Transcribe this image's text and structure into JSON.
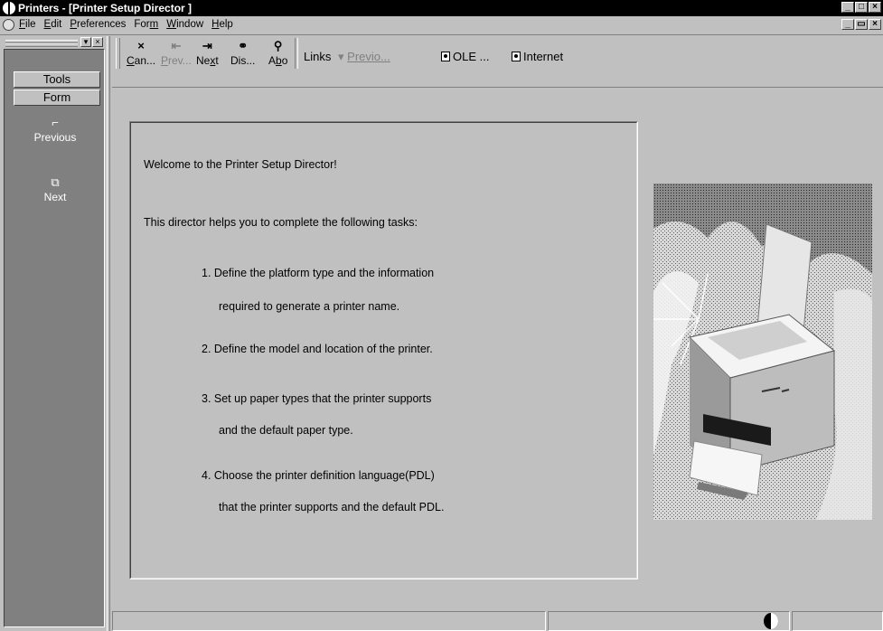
{
  "window": {
    "title": "Printers - [Printer Setup Director ]",
    "minimize": "_",
    "maximize": "□",
    "close": "×"
  },
  "menubar": {
    "items": [
      {
        "label": "File",
        "u": "F",
        "rest": "ile"
      },
      {
        "label": "Edit",
        "u": "E",
        "rest": "dit"
      },
      {
        "label": "Preferences",
        "u": "P",
        "rest": "references"
      },
      {
        "label": "Form",
        "pre": "For",
        "u": "m"
      },
      {
        "label": "Window",
        "u": "W",
        "rest": "indow"
      },
      {
        "label": "Help",
        "u": "H",
        "rest": "elp"
      }
    ],
    "restore": "▭",
    "close": "×"
  },
  "sidepanel": {
    "tools_label": "Tools",
    "form_label": "Form",
    "actions": [
      {
        "label": "Previous",
        "icon": "previous-icon"
      },
      {
        "label": "Next",
        "icon": "next-icon"
      }
    ]
  },
  "toolbar": {
    "buttons": [
      {
        "pre": "",
        "u": "C",
        "rest": "an...",
        "icon": "cancel-icon",
        "enabled": true
      },
      {
        "pre": "",
        "u": "P",
        "rest": "rev...",
        "icon": "prev-icon",
        "enabled": false
      },
      {
        "pre": "Ne",
        "u": "x",
        "rest": "t",
        "icon": "next-icon",
        "enabled": true
      },
      {
        "pre": "Dis...",
        "u": "",
        "rest": "",
        "icon": "display-icon",
        "enabled": true
      },
      {
        "pre": "A",
        "u": "b",
        "rest": "o",
        "icon": "about-icon",
        "enabled": true
      }
    ],
    "links_label": "Links",
    "previous_link": "Previo...",
    "ole_link": "OLE ...",
    "internet_link": "Internet"
  },
  "content": {
    "welcome": "Welcome to the Printer Setup Director!",
    "intro": "This director helps you to complete the following tasks:",
    "task1_line1": "1. Define the platform type and the information",
    "task1_line2": "required to generate a printer name.",
    "task2": "2. Define the model and location of the printer.",
    "task3_line1": "3. Set up paper types that the printer supports",
    "task3_line2": "and the default paper type.",
    "task4_line1": "4. Choose the printer definition language(PDL)",
    "task4_line2": "that the printer supports and the default PDL."
  },
  "illustration": {
    "name": "printer-illustration"
  },
  "colors": {
    "face": "#c0c0c0",
    "panel": "#808080",
    "titlebar": "#000000"
  }
}
